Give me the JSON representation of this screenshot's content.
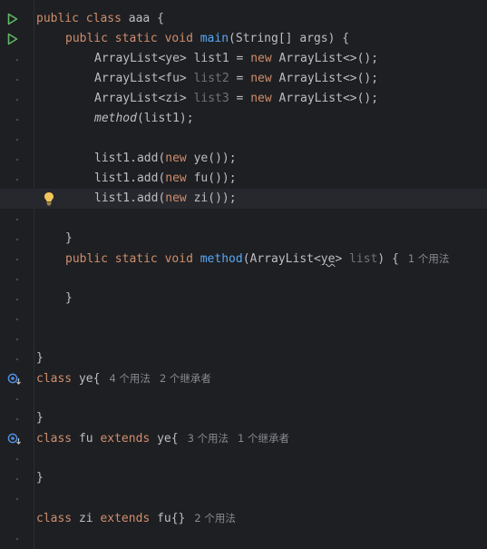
{
  "lines": {
    "l1": {
      "kw1": "public",
      "kw2": "class",
      "rest": " aaa {"
    },
    "l2": {
      "kw1": "public",
      "kw2": "static",
      "kw3": "void",
      "fn": "main",
      "rest": "(String[] args) {"
    },
    "l3": {
      "a": "ArrayList<ye> ",
      "var": "list1",
      "eq": " = ",
      "kw": "new",
      "b": " ArrayList<>();"
    },
    "l4": {
      "a": "ArrayList<fu> ",
      "var": "list2",
      "eq": " = ",
      "kw": "new",
      "b": " ArrayList<>();"
    },
    "l5": {
      "a": "ArrayList<zi> ",
      "var": "list3",
      "eq": " = ",
      "kw": "new",
      "b": " ArrayList<>();"
    },
    "l6": {
      "fn": "method",
      "rest": "(list1);"
    },
    "l8": {
      "a": "list1.add(",
      "kw": "new",
      "b": " ye());"
    },
    "l9": {
      "a": "list1.add(",
      "kw": "new",
      "b": " fu());"
    },
    "l10": {
      "a": "list1.add(",
      "kw": "new",
      "b": " zi());"
    },
    "l12": {
      "text": "}"
    },
    "l13": {
      "kw1": "public",
      "kw2": "static",
      "kw3": "void",
      "fn": "method",
      "a": "(ArrayList<",
      "sq": "ye",
      "b": "> ",
      "param": "list",
      "c": ") {",
      "hint": "1 个用法"
    },
    "l15": {
      "text": "}"
    },
    "l18": {
      "text": "}"
    },
    "l19": {
      "kw": "class",
      "rest": " ye{",
      "hint1": "4 个用法",
      "hint2": "2 个继承者"
    },
    "l21": {
      "text": "}"
    },
    "l22": {
      "kw1": "class",
      "mid": " fu ",
      "kw2": "extends",
      "rest": " ye{",
      "hint1": "3 个用法",
      "hint2": "1 个继承者"
    },
    "l24": {
      "text": "}"
    },
    "l26": {
      "kw1": "class",
      "mid": " zi ",
      "kw2": "extends",
      "rest": " fu{}",
      "hint": "2 个用法"
    }
  },
  "colors": {
    "keyword": "#cf8e6d",
    "function": "#56a8f5",
    "text": "#bcbec4",
    "dim": "#6f737a",
    "run": "#5fb865",
    "impl": "#4e8fe0",
    "bulb": "#f2c55c"
  }
}
